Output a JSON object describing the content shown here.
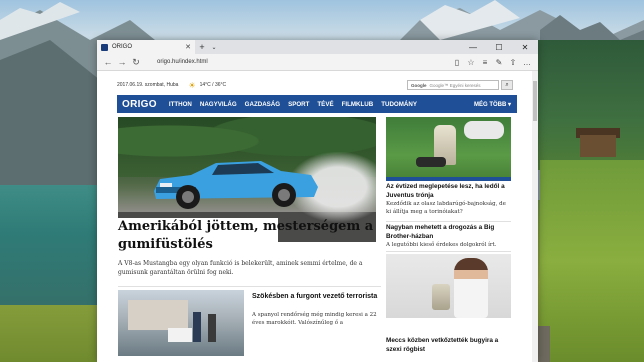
{
  "browser": {
    "tab_title": "ORIGO",
    "tab_close": "✕",
    "new_tab": "+",
    "tab_menu": "⌄",
    "window_controls": {
      "minimize": "—",
      "maximize": "☐",
      "close": "✕"
    },
    "address": "origo.hu/index.html",
    "nav": {
      "back": "←",
      "forward": "→",
      "refresh": "↻"
    },
    "nav_icons": {
      "reading": "▯",
      "favorite": "☆",
      "hub": "≡",
      "notes": "✎",
      "share": "⇧",
      "more": "…"
    }
  },
  "site": {
    "info": {
      "date": "2017.06.19. szombat, Huba",
      "weather_icon": "☀",
      "weather": "14°C / 36°C"
    },
    "search": {
      "label": "Google",
      "placeholder": "Google™ Egyéni keresés",
      "button": "⌕"
    },
    "logo": "ORIGO",
    "nav_items": [
      "ITTHON",
      "NAGYVILÁG",
      "GAZDASÁG",
      "SPORT",
      "TÉVÉ",
      "FILMKLUB",
      "TUDOMÁNY"
    ],
    "more": "MÉG TÖBB ▾",
    "hero": {
      "title": "Amerikából jöttem, mesterségem a gumifüstölés",
      "lead": "A V8-as Mustangba egy olyan funkció is belekerült, aminek semmi értelme, de a gumisunk garantáltan örülni fog neki."
    },
    "story2": {
      "title": "Szökésben a furgont vezető terrorista",
      "text": "A spanyol rendőrség még mindig keresi a 22 éves marokkóit. Valószínűleg ő a"
    },
    "side": [
      {
        "title": "Az évtized meglepetése lesz, ha ledől a Juventus trónja",
        "text": "Kezdődik az olasz labdarúgó-bajnokság, de ki állítja meg a torinóiakat?"
      },
      {
        "title": "Nagyban mehetett a drogozás a Big Brother-házban",
        "text": "A legutóbbi kieső érdekes dolgokról írt."
      },
      {
        "title": "Meccs közben vetkőztették bugyira a szexi rögbist",
        "text": ""
      }
    ]
  },
  "colors": {
    "nav_blue": "#1f4f97",
    "car_blue": "#3aa0e0"
  }
}
